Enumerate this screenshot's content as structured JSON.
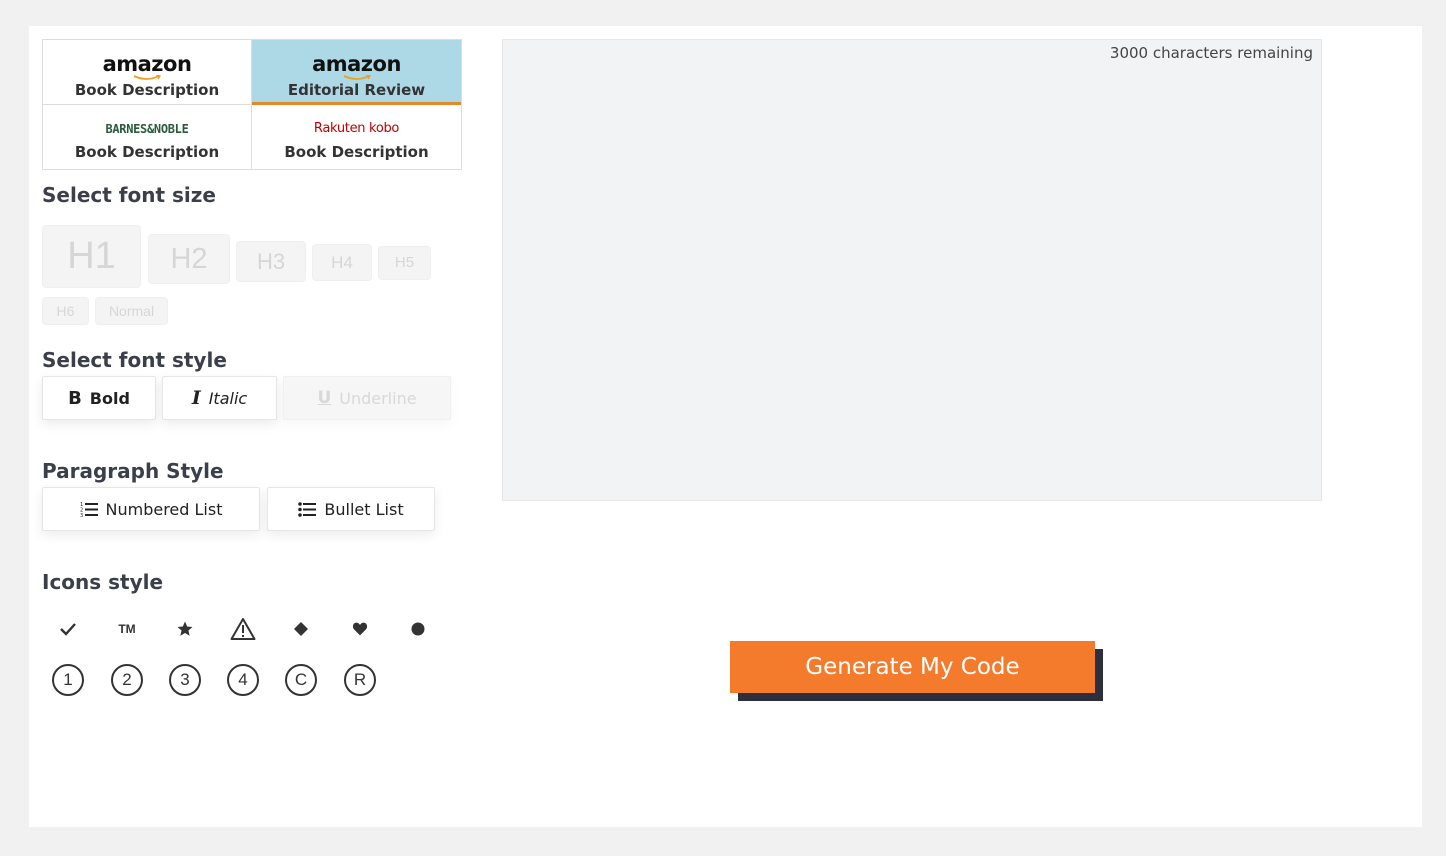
{
  "retailers": [
    {
      "brand": "amazon",
      "label": "Book Description",
      "active": false
    },
    {
      "brand": "amazon",
      "label": "Editorial Review",
      "active": true
    },
    {
      "brand": "BARNES&NOBLE",
      "label": "Book Description",
      "active": false
    },
    {
      "brand": "Rakuten kobo",
      "label": "Book Description",
      "active": false
    }
  ],
  "font_size": {
    "title": "Select font size",
    "options": [
      "H1",
      "H2",
      "H3",
      "H4",
      "H5",
      "H6",
      "Normal"
    ]
  },
  "font_style": {
    "title": "Select font style",
    "bold": "Bold",
    "italic": "Italic",
    "underline": "Underline"
  },
  "paragraph": {
    "title": "Paragraph Style",
    "numbered": "Numbered List",
    "bullet": "Bullet List"
  },
  "icons": {
    "title": "Icons style",
    "symbols": [
      "check-icon",
      "trademark-icon",
      "star-icon",
      "warning-icon",
      "diamond-icon",
      "heart-icon",
      "dot-icon"
    ],
    "trademark": "TM",
    "circled": [
      "1",
      "2",
      "3",
      "4",
      "C",
      "R"
    ]
  },
  "editor": {
    "counter": "3000 characters remaining"
  },
  "generate_label": "Generate My Code",
  "colors": {
    "accent": "#f47a2c",
    "active_tab": "#add8e6",
    "active_underline": "#e08a2b",
    "button_shadow": "#2b2f3e"
  }
}
